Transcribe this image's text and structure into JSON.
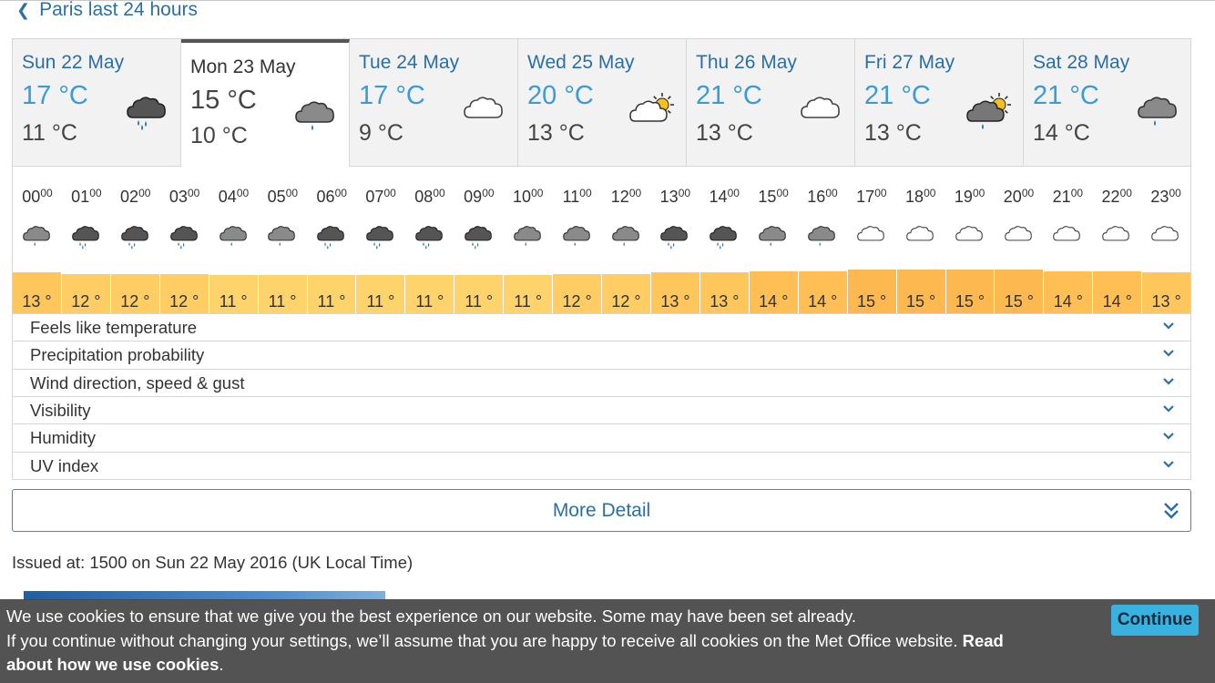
{
  "nav": {
    "back_label": "Paris last 24 hours"
  },
  "days": [
    {
      "day": "Sun 22 May",
      "high": "17 °C",
      "low": "11 °C",
      "icon": "heavy-rain-cloud-icon",
      "selected": false
    },
    {
      "day": "Mon 23 May",
      "high": "15 °C",
      "low": "10 °C",
      "icon": "light-rain-cloud-icon",
      "selected": true
    },
    {
      "day": "Tue 24 May",
      "high": "17 °C",
      "low": "9 °C",
      "icon": "cloud-icon",
      "selected": false
    },
    {
      "day": "Wed 25 May",
      "high": "20 °C",
      "low": "13 °C",
      "icon": "sun-cloud-icon",
      "selected": false
    },
    {
      "day": "Thu 26 May",
      "high": "21 °C",
      "low": "13 °C",
      "icon": "cloud-icon",
      "selected": false
    },
    {
      "day": "Fri 27 May",
      "high": "21 °C",
      "low": "13 °C",
      "icon": "sun-rain-cloud-icon",
      "selected": false
    },
    {
      "day": "Sat 28 May",
      "high": "21 °C",
      "low": "14 °C",
      "icon": "light-rain-cloud-icon",
      "selected": false
    }
  ],
  "hours": [
    {
      "h": "00",
      "m": "00",
      "icon": "light-rain-cloud-icon",
      "temp": "13 °"
    },
    {
      "h": "01",
      "m": "00",
      "icon": "heavy-rain-cloud-icon",
      "temp": "12 °"
    },
    {
      "h": "02",
      "m": "00",
      "icon": "heavy-rain-cloud-icon",
      "temp": "12 °"
    },
    {
      "h": "03",
      "m": "00",
      "icon": "heavy-rain-cloud-icon",
      "temp": "12 °"
    },
    {
      "h": "04",
      "m": "00",
      "icon": "light-rain-cloud-icon",
      "temp": "11 °"
    },
    {
      "h": "05",
      "m": "00",
      "icon": "light-rain-cloud-icon",
      "temp": "11 °"
    },
    {
      "h": "06",
      "m": "00",
      "icon": "heavy-rain-cloud-icon",
      "temp": "11 °"
    },
    {
      "h": "07",
      "m": "00",
      "icon": "heavy-rain-cloud-icon",
      "temp": "11 °"
    },
    {
      "h": "08",
      "m": "00",
      "icon": "heavy-rain-cloud-icon",
      "temp": "11 °"
    },
    {
      "h": "09",
      "m": "00",
      "icon": "heavy-rain-cloud-icon",
      "temp": "11 °"
    },
    {
      "h": "10",
      "m": "00",
      "icon": "light-rain-cloud-icon",
      "temp": "11 °"
    },
    {
      "h": "11",
      "m": "00",
      "icon": "light-rain-cloud-icon",
      "temp": "12 °"
    },
    {
      "h": "12",
      "m": "00",
      "icon": "light-rain-cloud-icon",
      "temp": "12 °"
    },
    {
      "h": "13",
      "m": "00",
      "icon": "heavy-rain-cloud-icon",
      "temp": "13 °"
    },
    {
      "h": "14",
      "m": "00",
      "icon": "heavy-rain-cloud-icon",
      "temp": "13 °"
    },
    {
      "h": "15",
      "m": "00",
      "icon": "light-rain-cloud-icon",
      "temp": "14 °"
    },
    {
      "h": "16",
      "m": "00",
      "icon": "light-rain-cloud-icon",
      "temp": "14 °"
    },
    {
      "h": "17",
      "m": "00",
      "icon": "cloud-icon",
      "temp": "15 °"
    },
    {
      "h": "18",
      "m": "00",
      "icon": "cloud-icon",
      "temp": "15 °"
    },
    {
      "h": "19",
      "m": "00",
      "icon": "cloud-icon",
      "temp": "15 °"
    },
    {
      "h": "20",
      "m": "00",
      "icon": "cloud-icon",
      "temp": "15 °"
    },
    {
      "h": "21",
      "m": "00",
      "icon": "cloud-icon",
      "temp": "14 °"
    },
    {
      "h": "22",
      "m": "00",
      "icon": "cloud-icon",
      "temp": "14 °"
    },
    {
      "h": "23",
      "m": "00",
      "icon": "cloud-icon",
      "temp": "13 °"
    }
  ],
  "sections": [
    "Feels like temperature",
    "Precipitation probability",
    "Wind direction, speed & gust",
    "Visibility",
    "Humidity",
    "UV index"
  ],
  "more_detail_label": "More Detail",
  "issued": "Issued at: 1500 on Sun 22 May 2016 (UK Local Time)",
  "cookie": {
    "line1": "We use cookies to ensure that we give you the best experience on our website. Some may have been set already.",
    "line2": "If you continue without changing your settings, we’ll assume that you are happy to receive all cookies on the Met Office website.",
    "link_part1": "Read",
    "link_part2": "about how we use cookies",
    "end": ".",
    "button": "Continue"
  },
  "colors": {
    "link": "#2a6fa8",
    "high_temp": "#3a9bd6",
    "temp_11": "#ffd36b",
    "temp_12": "#ffcd63",
    "temp_13": "#ffc65b",
    "temp_14": "#ffbf55",
    "temp_15": "#feb850",
    "cookie_bg": "#464646",
    "continue_bg": "#3ab2e0"
  }
}
